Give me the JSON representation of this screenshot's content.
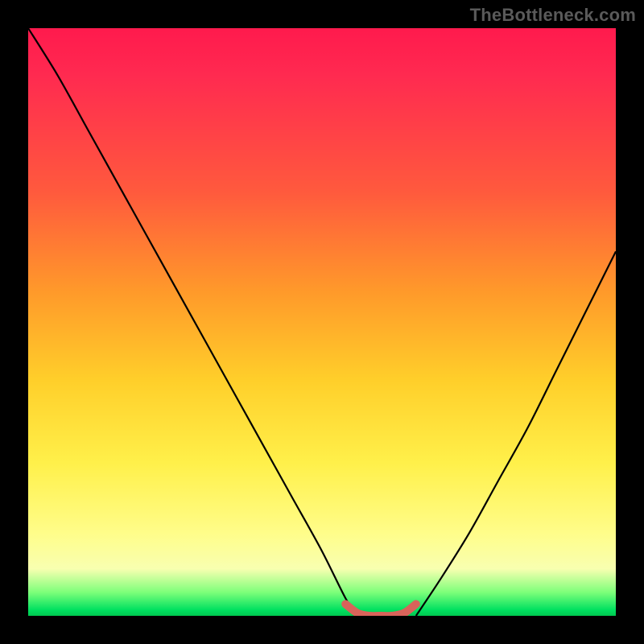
{
  "watermark": "TheBottleneck.com",
  "colors": {
    "frame": "#000000",
    "watermark_text": "#5a5a5a",
    "curve": "#000000",
    "flat_mark": "#d9635a",
    "gradient_stops": [
      "#ff1a4d",
      "#ff5a3d",
      "#ff9a2a",
      "#ffcf2a",
      "#fff04a",
      "#fffd8a",
      "#7dff7a",
      "#00c850"
    ]
  },
  "chart_data": {
    "type": "line",
    "title": "",
    "xlabel": "",
    "ylabel": "",
    "xlim": [
      0,
      100
    ],
    "ylim": [
      0,
      100
    ],
    "grid": false,
    "legend": false,
    "series": [
      {
        "name": "left-curve",
        "x": [
          0,
          5,
          10,
          15,
          20,
          25,
          30,
          35,
          40,
          45,
          50,
          54,
          56
        ],
        "values": [
          100,
          92,
          83,
          74,
          65,
          56,
          47,
          38,
          29,
          20,
          11,
          3,
          0
        ]
      },
      {
        "name": "right-curve",
        "x": [
          66,
          70,
          75,
          80,
          85,
          90,
          95,
          100
        ],
        "values": [
          0,
          6,
          14,
          23,
          32,
          42,
          52,
          62
        ]
      },
      {
        "name": "flat-region",
        "x": [
          54,
          56,
          58,
          60,
          62,
          64,
          66
        ],
        "values": [
          2,
          0.5,
          0,
          0,
          0,
          0.5,
          2
        ]
      }
    ],
    "notes": "V-shaped bottleneck curve over a vertical red-to-green heat gradient; minimum (optimal) region highlighted near x≈54–66."
  }
}
